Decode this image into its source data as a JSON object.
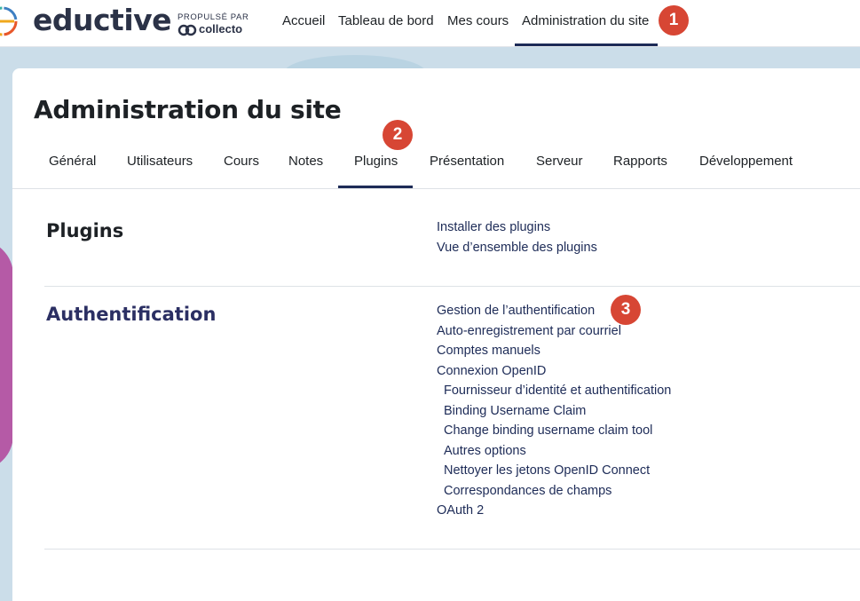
{
  "brand": {
    "name": "eductive",
    "powered_by": "PROPULSÉ PAR",
    "partner": "collecto"
  },
  "topnav": {
    "items": [
      {
        "label": "Accueil"
      },
      {
        "label": "Tableau de bord"
      },
      {
        "label": "Mes cours"
      },
      {
        "label": "Administration du site"
      }
    ],
    "active_index": 3
  },
  "page": {
    "title": "Administration du site"
  },
  "tabs": {
    "items": [
      {
        "label": "Général"
      },
      {
        "label": "Utilisateurs"
      },
      {
        "label": "Cours"
      },
      {
        "label": "Notes"
      },
      {
        "label": "Plugins"
      },
      {
        "label": "Présentation"
      },
      {
        "label": "Serveur"
      },
      {
        "label": "Rapports"
      },
      {
        "label": "Développement"
      }
    ],
    "active_index": 4
  },
  "sections": [
    {
      "title": "Plugins",
      "links": [
        {
          "label": "Installer des plugins"
        },
        {
          "label": "Vue d’ensemble des plugins"
        }
      ]
    },
    {
      "title": "Authentification",
      "links": [
        {
          "label": "Gestion de l’authentification"
        },
        {
          "label": "Auto-enregistrement par courriel"
        },
        {
          "label": "Comptes manuels"
        },
        {
          "label": "Connexion OpenID"
        },
        {
          "label": "Fournisseur d’identité et authentification",
          "indent": 1
        },
        {
          "label": "Binding Username Claim",
          "indent": 1
        },
        {
          "label": "Change binding username claim tool",
          "indent": 1
        },
        {
          "label": "Autres options",
          "indent": 1
        },
        {
          "label": "Nettoyer les jetons OpenID Connect",
          "indent": 1
        },
        {
          "label": "Correspondances de champs",
          "indent": 1
        },
        {
          "label": "OAuth 2"
        }
      ]
    }
  ],
  "annotations": [
    "1",
    "2",
    "3"
  ],
  "colors": {
    "accent": "#1d2b57",
    "badge": "#d74634",
    "plugins_title": "#1d2125",
    "auth_title": "#2b2f63",
    "background": "#cbdde9",
    "decor_purple": "#b55aa6"
  },
  "icons": {
    "logo": "eductive-logo-icon",
    "partner": "collecto-logo-icon"
  }
}
